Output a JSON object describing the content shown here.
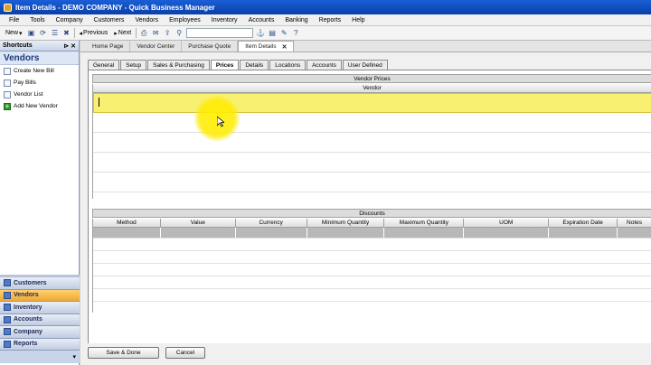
{
  "window": {
    "title": "Item Details - DEMO COMPANY - Quick Business Manager"
  },
  "menu": [
    "File",
    "Tools",
    "Company",
    "Customers",
    "Vendors",
    "Employees",
    "Inventory",
    "Accounts",
    "Banking",
    "Reports",
    "Help"
  ],
  "toolbar": {
    "new_label": "New",
    "previous_label": "Previous",
    "next_label": "Next"
  },
  "sidebar": {
    "header": "Shortcuts",
    "section_title": "Vendors",
    "items": [
      {
        "label": "Create New Bill",
        "icon": "document-icon"
      },
      {
        "label": "Pay Bills",
        "icon": "document-icon"
      },
      {
        "label": "Vendor List",
        "icon": "document-icon"
      },
      {
        "label": "Add New Vendor",
        "icon": "add-icon"
      }
    ],
    "nav": [
      {
        "label": "Customers",
        "active": false
      },
      {
        "label": "Vendors",
        "active": true
      },
      {
        "label": "Inventory",
        "active": false
      },
      {
        "label": "Accounts",
        "active": false
      },
      {
        "label": "Company",
        "active": false
      },
      {
        "label": "Reports",
        "active": false
      }
    ]
  },
  "doc_tabs": [
    {
      "label": "Home Page",
      "active": false
    },
    {
      "label": "Vendor Center",
      "active": false
    },
    {
      "label": "Purchase Quote",
      "active": false
    },
    {
      "label": "Item Details",
      "active": true
    }
  ],
  "inner_tabs": [
    {
      "label": "General",
      "active": false
    },
    {
      "label": "Setup",
      "active": false
    },
    {
      "label": "Sales & Purchasing",
      "active": false
    },
    {
      "label": "Prices",
      "active": true
    },
    {
      "label": "Details",
      "active": false
    },
    {
      "label": "Locations",
      "active": false
    },
    {
      "label": "Accounts",
      "active": false
    },
    {
      "label": "User Defined",
      "active": false
    }
  ],
  "vendor_prices": {
    "title": "Vendor Prices",
    "column": "Vendor"
  },
  "discounts": {
    "title": "Discounts",
    "columns": [
      "Method",
      "Value",
      "Currency",
      "Minimum Quantity",
      "Maximum Quantity",
      "UOM",
      "Expiration Date",
      "Notes"
    ]
  },
  "buttons": {
    "save_done": "Save & Done",
    "cancel": "Cancel"
  }
}
